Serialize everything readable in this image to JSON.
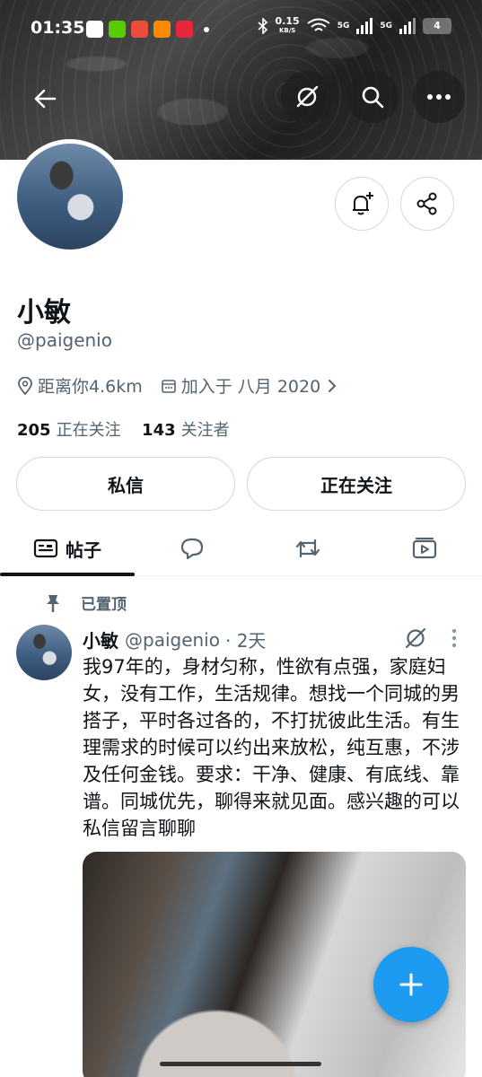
{
  "status_bar": {
    "time": "01:35",
    "net_speed_value": "0.15",
    "net_speed_unit": "KB/S",
    "signal_1": "5G",
    "signal_2": "5G",
    "battery": "4"
  },
  "profile": {
    "name": "小敏",
    "handle": "@paigenio",
    "location": "距离你4.6km",
    "joined": "加入于 八月 2020",
    "following_count": "205",
    "following_label": "正在关注",
    "followers_count": "143",
    "followers_label": "关注者"
  },
  "actions": {
    "message_label": "私信",
    "following_button_label": "正在关注"
  },
  "tabs": {
    "posts_label": "帖子"
  },
  "pinned_post": {
    "pinned_label": "已置顶",
    "author_name": "小敏",
    "author_handle": "@paigenio",
    "time": "· 2天",
    "text": "我97年的，身材匀称，性欲有点强，家庭妇女，没有工作，生活规律。想找一个同城的男搭子，平时各过各的，不打扰彼此生活。有生理需求的时候可以约出来放松，纯互惠，不涉及任何金钱。要求：干净、健康、有底线、靠谱。同城优先，聊得来就见面。感兴趣的可以私信留言聊聊"
  },
  "colors": {
    "accent": "#1d9bf0",
    "secondary_text": "#536471",
    "border": "#cfd9de"
  }
}
